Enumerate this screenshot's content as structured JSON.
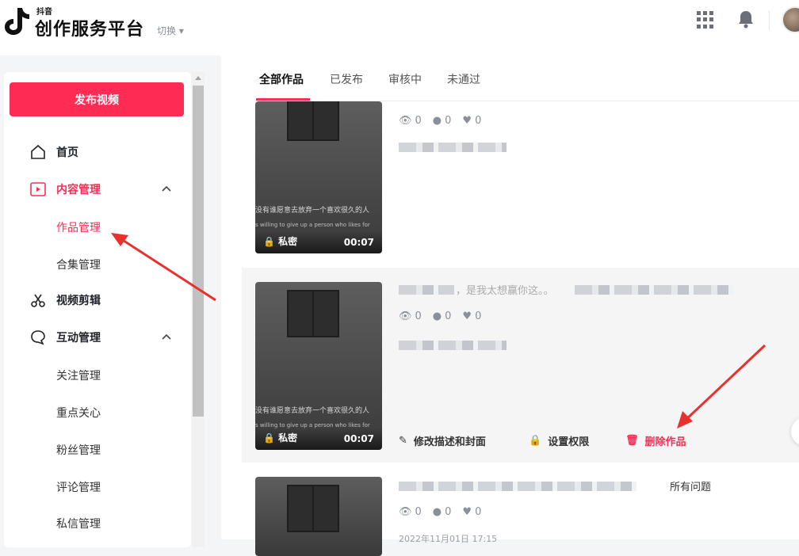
{
  "header": {
    "brand_small": "抖音",
    "brand_main": "创作服务平台",
    "switch_label": "切换 ▾"
  },
  "sidebar": {
    "publish_label": "发布视频",
    "items": [
      {
        "label": "首页"
      },
      {
        "label": "内容管理"
      },
      {
        "label": "作品管理"
      },
      {
        "label": "合集管理"
      },
      {
        "label": "视频剪辑"
      },
      {
        "label": "互动管理"
      },
      {
        "label": "关注管理"
      },
      {
        "label": "重点关心"
      },
      {
        "label": "粉丝管理"
      },
      {
        "label": "评论管理"
      },
      {
        "label": "私信管理"
      }
    ]
  },
  "tabs": [
    "全部作品",
    "已发布",
    "审核中",
    "未通过"
  ],
  "works": [
    {
      "views": "0",
      "comments": "0",
      "likes": "0",
      "privacy": "私密",
      "duration": "00:07",
      "caption1": "没有谁愿意去放弃一个喜欢很久的人",
      "caption2": "s willing to give up a person who likes for"
    },
    {
      "title_visible": "，是我太想赢你这。。",
      "views": "0",
      "comments": "0",
      "likes": "0",
      "privacy": "私密",
      "duration": "00:07",
      "caption1": "没有谁愿意去放弃一个喜欢很久的人",
      "caption2": "s willing to give up a person who likes for",
      "actions": {
        "edit": "修改描述和封面",
        "perm": "设置权限",
        "delete": "删除作品"
      }
    },
    {
      "title_visible": "所有问题",
      "views": "0",
      "comments": "0",
      "likes": "0",
      "date": "2022年11月01日 17:15"
    }
  ],
  "colors": {
    "accent": "#fe2c55",
    "arrow": "#e8312f"
  }
}
